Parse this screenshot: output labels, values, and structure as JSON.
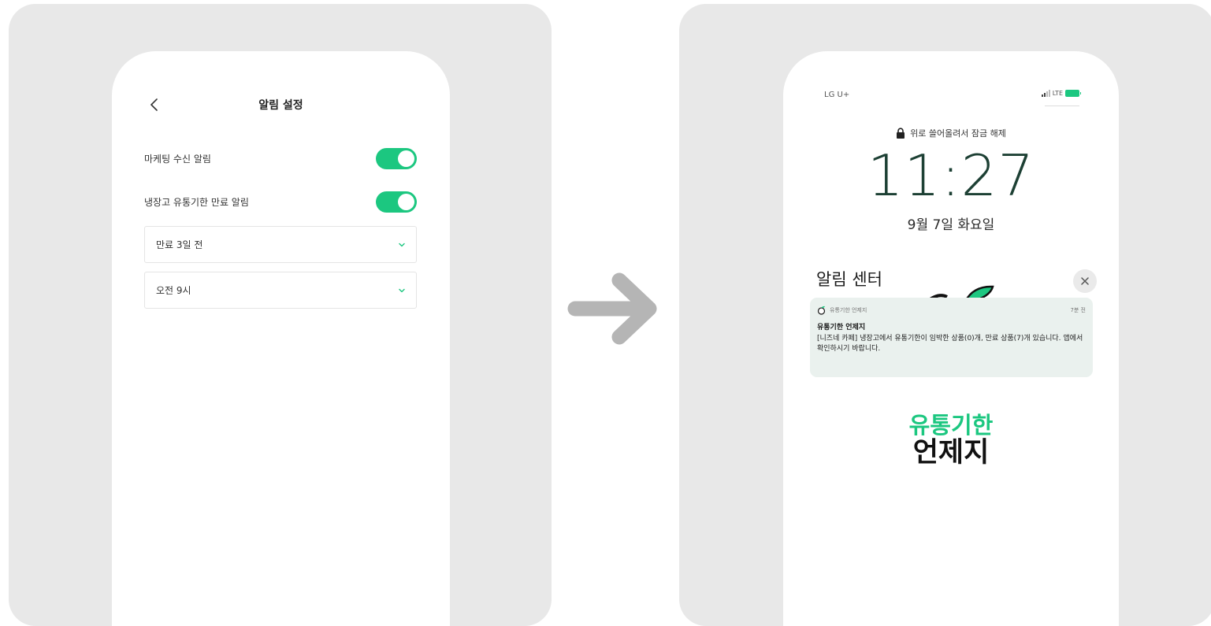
{
  "colors": {
    "accent": "#1cc780",
    "panel_background": "#e8e8e8",
    "arrow": "#b5b5b5",
    "clock": "#1d4034",
    "notification_background": "#eaf1ee"
  },
  "settings_screen": {
    "back_icon": "chevron-left-icon",
    "title": "알림 설정",
    "marketing_toggle": {
      "label": "마케팅 수신 알림",
      "on": true
    },
    "expiry_toggle": {
      "label": "냉장고 유통기한 만료 알림",
      "on": true
    },
    "days_before_select": {
      "value": "만료 3일 전",
      "icon": "chevron-down-icon"
    },
    "time_select": {
      "value": "오전 9시",
      "icon": "chevron-down-icon"
    }
  },
  "transition_arrow": {
    "icon": "arrow-right-icon"
  },
  "lock_screen": {
    "status_bar": {
      "carrier": "LG U+",
      "network": "LTE"
    },
    "unlock_hint": "위로 쓸어올려서 잠금 해제",
    "time": "11:27",
    "date": "9월 7일 화요일",
    "notification_center_title": "알림 센터",
    "close_icon": "close-icon",
    "notification": {
      "app_name": "유통기한 언제지",
      "time_ago": "7분 전",
      "title": "유통기한 언제지",
      "body": "[니즈네 카페] 냉장고에서 유통기한이 임박한 상품(0)개, 만료 상품(7)개 있습니다. 앱에서 확인하시기 바랍니다."
    },
    "logo": {
      "line1": "유통기한",
      "line2": "언제지"
    }
  }
}
